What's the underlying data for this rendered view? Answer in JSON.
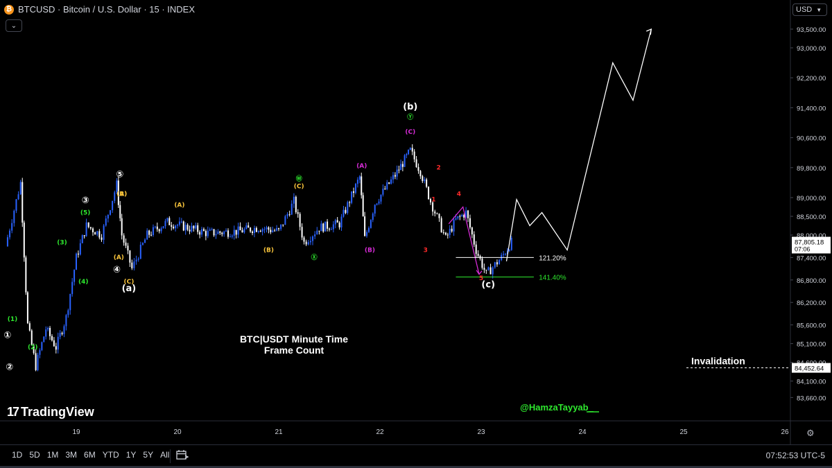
{
  "header": {
    "symbol_title": "BTCUSD · Bitcoin / U.S. Dollar · 15 · INDEX",
    "symbol_icon": "bitcoin-icon",
    "dropdown_icon": "chevron-down-icon"
  },
  "currency": {
    "label": "USD"
  },
  "watermark": {
    "brand": "TradingView",
    "author": "@HamzaTayyab_"
  },
  "toolbar": {
    "periods": [
      "1D",
      "5D",
      "1M",
      "3M",
      "6M",
      "YTD",
      "1Y",
      "5Y",
      "All"
    ],
    "time": "07:52:53 UTC-5",
    "calendar_icon": "calendar-range-icon",
    "settings_icon": "gear-icon"
  },
  "colors": {
    "candle_up": "#2962ff",
    "candle_down": "#ffffff",
    "projection": "#ffffff",
    "yellow": "#f7c33b",
    "green": "#2ee82e",
    "magenta": "#d62bd6",
    "red": "#ff2a2a",
    "axis_text": "#d1d4dc",
    "background": "#000000"
  },
  "chart_data": {
    "type": "line",
    "title": "BTC|USDT Minute Time\nFrame Count",
    "xlabel": "",
    "ylabel": "",
    "x_ticks": [
      "19",
      "20",
      "21",
      "22",
      "23",
      "24",
      "25",
      "26"
    ],
    "y_ticks": [
      "93,500.00",
      "93,000.00",
      "92,200.00",
      "91,400.00",
      "90,600.00",
      "89,800.00",
      "89,000.00",
      "88,500.00",
      "88,000.00",
      "87,400.00",
      "86,800.00",
      "86,200.00",
      "85,600.00",
      "85,100.00",
      "84,600.00",
      "84,100.00",
      "83,660.00"
    ],
    "ylim": [
      83500,
      93800
    ],
    "grid": false,
    "series": [
      {
        "style": "candles",
        "x": [
          18.3,
          18.45,
          18.52,
          18.6,
          18.7,
          18.8,
          18.9,
          19.0,
          19.1,
          19.25,
          19.4,
          19.45,
          19.55,
          19.7,
          19.9,
          20.1,
          20.3,
          20.6,
          20.8,
          21.0,
          21.15,
          21.25,
          21.4,
          21.6,
          21.8,
          21.85,
          21.95,
          22.15,
          22.3,
          22.4,
          22.5,
          22.65,
          22.75,
          22.85,
          22.95,
          23.05,
          23.2,
          23.3
        ],
        "y": [
          87700,
          89400,
          85600,
          84500,
          85500,
          85000,
          85800,
          87400,
          88250,
          88000,
          89350,
          88000,
          87100,
          88000,
          88350,
          88200,
          88050,
          88100,
          88200,
          88100,
          88900,
          87800,
          88200,
          88300,
          89550,
          87900,
          88850,
          89600,
          90250,
          89700,
          88900,
          87900,
          88400,
          88600,
          87600,
          86950,
          87400,
          87805
        ]
      },
      {
        "name": "",
        "style": "projection",
        "x": [
          23.25,
          23.35,
          23.48,
          23.6,
          23.85,
          24.3,
          24.5,
          24.68
        ],
        "y": [
          87300,
          88950,
          88250,
          88600,
          87600,
          92600,
          91600,
          93500
        ]
      }
    ],
    "last_price": {
      "value": "87,805.18",
      "countdown": "07:06"
    },
    "levels": [
      {
        "label": "121.20%",
        "value": 87400
      },
      {
        "label": "141.40%",
        "value": 86880
      },
      {
        "label": "Invalidation",
        "value": 84452.64,
        "price_label": "84,452.64"
      }
    ],
    "annotations": [
      {
        "text": "①",
        "x": 18.32,
        "y": 85250,
        "color": "white"
      },
      {
        "text": "②",
        "x": 18.34,
        "y": 84400,
        "color": "white"
      },
      {
        "text": "③",
        "x": 19.09,
        "y": 88850,
        "color": "white"
      },
      {
        "text": "④",
        "x": 19.4,
        "y": 87000,
        "color": "white"
      },
      {
        "text": "⑤",
        "x": 19.43,
        "y": 89550,
        "color": "white"
      },
      {
        "text": "(a)",
        "x": 19.52,
        "y": 86500,
        "color": "white"
      },
      {
        "text": "(b)",
        "x": 22.3,
        "y": 91350,
        "color": "white"
      },
      {
        "text": "(c)",
        "x": 23.07,
        "y": 86600,
        "color": "white"
      },
      {
        "text": "(1)",
        "x": 18.37,
        "y": 85700,
        "color": "green"
      },
      {
        "text": "(2)",
        "x": 18.57,
        "y": 84950,
        "color": "green"
      },
      {
        "text": "(3)",
        "x": 18.86,
        "y": 87750,
        "color": "green"
      },
      {
        "text": "(4)",
        "x": 19.07,
        "y": 86700,
        "color": "green"
      },
      {
        "text": "(5)",
        "x": 19.09,
        "y": 88550,
        "color": "green"
      },
      {
        "text": "Ⓦ",
        "x": 21.2,
        "y": 89450,
        "color": "green"
      },
      {
        "text": "Ⓧ",
        "x": 21.35,
        "y": 87350,
        "color": "green"
      },
      {
        "text": "Ⓨ",
        "x": 22.3,
        "y": 91100,
        "color": "green"
      },
      {
        "text": "(A)",
        "x": 19.45,
        "y": 89050,
        "color": "yellow"
      },
      {
        "text": "(A)",
        "x": 19.42,
        "y": 87350,
        "color": "yellow"
      },
      {
        "text": "(B)",
        "x": 19.45,
        "y": 89050,
        "color": "yellow"
      },
      {
        "text": "(C)",
        "x": 19.52,
        "y": 86700,
        "color": "yellow"
      },
      {
        "text": "(A)",
        "x": 20.02,
        "y": 88750,
        "color": "yellow"
      },
      {
        "text": "(B)",
        "x": 20.9,
        "y": 87550,
        "color": "yellow"
      },
      {
        "text": "(C)",
        "x": 21.2,
        "y": 89250,
        "color": "yellow"
      },
      {
        "text": "(A)",
        "x": 21.82,
        "y": 89800,
        "color": "magenta"
      },
      {
        "text": "(B)",
        "x": 21.9,
        "y": 87550,
        "color": "magenta"
      },
      {
        "text": "(C)",
        "x": 22.3,
        "y": 90700,
        "color": "magenta"
      },
      {
        "text": "1",
        "x": 22.53,
        "y": 88900,
        "color": "red"
      },
      {
        "text": "2",
        "x": 22.58,
        "y": 89750,
        "color": "red"
      },
      {
        "text": "3",
        "x": 22.45,
        "y": 87550,
        "color": "red"
      },
      {
        "text": "4",
        "x": 22.78,
        "y": 89050,
        "color": "red"
      },
      {
        "text": "5",
        "x": 23.0,
        "y": 86800,
        "color": "red"
      }
    ]
  }
}
